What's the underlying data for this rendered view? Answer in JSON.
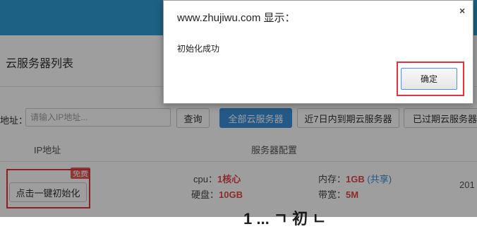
{
  "page": {
    "title": "云服务器列表",
    "filter_label": "地址：",
    "ip_placeholder": "请输入IP地址...",
    "buttons": {
      "query": "查询",
      "all_servers": "全部云服务器",
      "expiring_7d": "近7日内到期云服务器",
      "expired": "已过期云服务器"
    },
    "table": {
      "headers": {
        "ip": "IP地址",
        "config": "服务器配置"
      },
      "row": {
        "init_button": "点击一键初始化",
        "badge": "免费",
        "cpu_label": "cpu：",
        "cpu_value": "1核心",
        "disk_label": "硬盘：",
        "disk_value": "10GB",
        "memory_label": "内存：",
        "memory_value": "1GB",
        "memory_note": "(共享)",
        "bandwidth_label": "带宽：",
        "bandwidth_value": "5M",
        "date_partial": "201"
      }
    },
    "bottom_partial_text": "1 ... ㄱ 初 ㄴ"
  },
  "dialog": {
    "title": "www.zhujiwu.com 显示：",
    "message": "初始化成功",
    "ok_label": "确定",
    "close_symbol": "×"
  },
  "colors": {
    "topbar": "#2f9fd6",
    "primary_button": "#3b8ed8",
    "highlight_red": "#e8323b",
    "value_red": "#e04848"
  }
}
